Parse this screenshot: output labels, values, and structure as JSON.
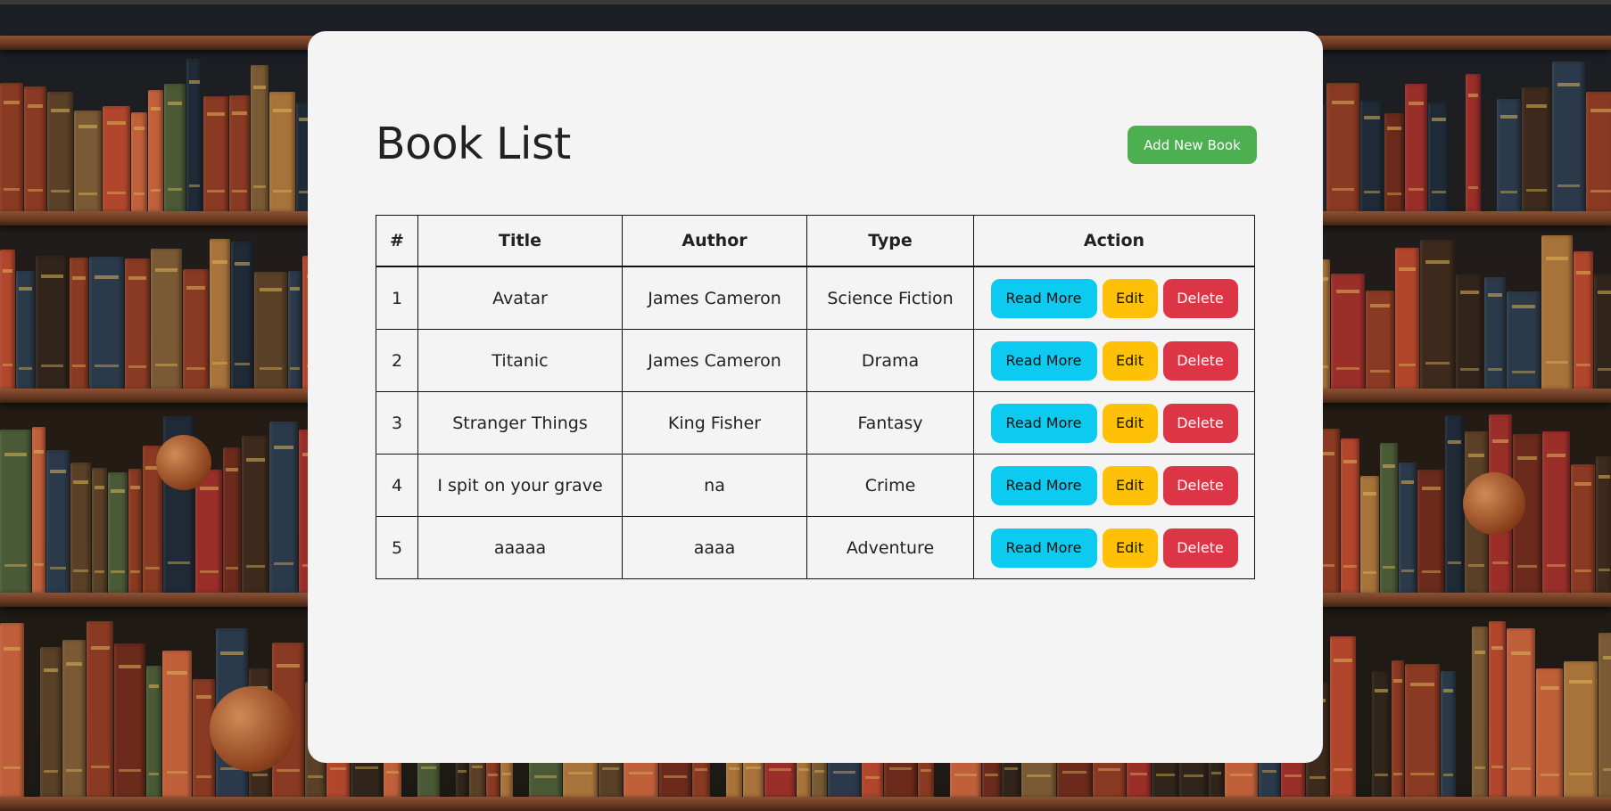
{
  "page": {
    "title": "Book List"
  },
  "toolbar": {
    "add_label": "Add New Book"
  },
  "table": {
    "headers": [
      "#",
      "Title",
      "Author",
      "Type",
      "Action"
    ],
    "rows": [
      {
        "num": "1",
        "title": "Avatar",
        "author": "James Cameron",
        "type": "Science Fiction"
      },
      {
        "num": "2",
        "title": "Titanic",
        "author": "James Cameron",
        "type": "Drama"
      },
      {
        "num": "3",
        "title": "Stranger Things",
        "author": "King Fisher",
        "type": "Fantasy"
      },
      {
        "num": "4",
        "title": "I spit on your grave",
        "author": "na",
        "type": "Crime"
      },
      {
        "num": "5",
        "title": "aaaaa",
        "author": "aaaa",
        "type": "Adventure"
      }
    ]
  },
  "actions": {
    "read_more": "Read More",
    "edit": "Edit",
    "delete": "Delete"
  },
  "colors": {
    "card_bg": "#f4f4f4",
    "add_button": "#4caf50",
    "read_more": "#0dcaf0",
    "edit": "#ffc107",
    "delete": "#dc3545"
  }
}
